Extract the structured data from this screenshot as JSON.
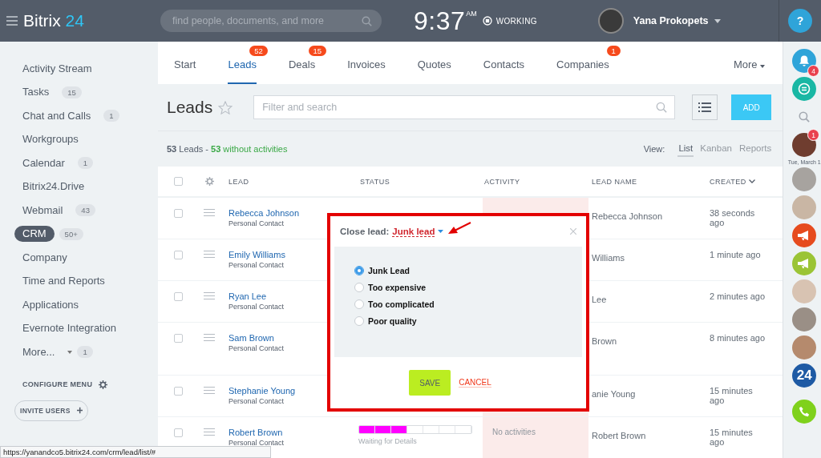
{
  "header": {
    "logo": "Bitrix",
    "logo_accent": "24",
    "search": {
      "placeholder": "find people, documents, and more"
    },
    "time": "9:37",
    "ampm": "AM",
    "work_status": "WORKING",
    "user": "Yana Prokopets",
    "help": "?"
  },
  "tabs": [
    {
      "label": "Start",
      "selected": false
    },
    {
      "label": "Leads",
      "badge": "52",
      "selected": true
    },
    {
      "label": "Deals",
      "badge": "15",
      "selected": false
    },
    {
      "label": "Invoices",
      "selected": false
    },
    {
      "label": "Quotes",
      "selected": false
    },
    {
      "label": "Contacts",
      "selected": false
    },
    {
      "label": "Companies",
      "badge": "1",
      "selected": false
    }
  ],
  "more_tab": "More",
  "sidebar": {
    "items": [
      {
        "label": "Activity Stream",
        "selected": false
      },
      {
        "label": "Tasks",
        "count": "15",
        "selected": false
      },
      {
        "label": "Chat and Calls",
        "count": "1",
        "selected": false
      },
      {
        "label": "Workgroups",
        "selected": false
      },
      {
        "label": "Calendar",
        "count": "1",
        "selected": false
      },
      {
        "label": "Bitrix24.Drive",
        "selected": false
      },
      {
        "label": "Webmail",
        "count": "43",
        "selected": false
      },
      {
        "label": "CRM",
        "count": "50+",
        "selected": true
      },
      {
        "label": "Company",
        "selected": false
      },
      {
        "label": "Time and Reports",
        "selected": false
      },
      {
        "label": "Applications",
        "selected": false
      },
      {
        "label": "Evernote Integration",
        "selected": false
      },
      {
        "label": "More...",
        "count": "1",
        "selected": false,
        "kind": "dropdown"
      }
    ],
    "configure": "CONFIGURE MENU",
    "invite": "INVITE USERS"
  },
  "page": {
    "title": "Leads",
    "filter": {
      "placeholder": "Filter and search"
    },
    "add": "ADD"
  },
  "summary": {
    "total": "53",
    "total_label": "Leads -",
    "count": "53",
    "count_label": "without activities"
  },
  "view": {
    "label": "View:",
    "options": [
      {
        "label": "List",
        "selected": true
      },
      {
        "label": "Kanban",
        "selected": false
      },
      {
        "label": "Reports",
        "selected": false
      }
    ]
  },
  "table": {
    "all_checked": false,
    "columns": [
      "LEAD",
      "STATUS",
      "ACTIVITY",
      "LEAD NAME",
      "CREATED"
    ],
    "rows": [
      {
        "checked": false,
        "name": "Rebecca Johnson",
        "subtitle": "Personal Contact",
        "lead_name": "Rebecca Johnson",
        "created": "38 seconds ago"
      },
      {
        "checked": false,
        "name": "Emily Williams",
        "subtitle": "Personal Contact",
        "lead_name": "Williams",
        "created": "1 minute ago"
      },
      {
        "checked": false,
        "name": "Ryan Lee",
        "subtitle": "Personal Contact",
        "lead_name": "Lee",
        "created": "2 minutes ago"
      },
      {
        "checked": false,
        "name": "Sam Brown",
        "subtitle": "Personal Contact",
        "lead_name": "Brown",
        "created": "8 minutes ago"
      },
      {
        "checked": false,
        "name": "Stephanie Young",
        "subtitle": "Personal Contact",
        "lead_name": "anie Young",
        "created": "15 minutes ago"
      },
      {
        "checked": false,
        "name": "Robert Brown",
        "subtitle": "Personal Contact",
        "lead_name": "Robert Brown",
        "created": "15 minutes ago",
        "status": {
          "level": 0.43,
          "label": "Waiting for Details",
          "color": "#ff00ff"
        },
        "activity": "No activities"
      }
    ]
  },
  "modal": {
    "title": "Close lead:",
    "value": "Junk lead",
    "options": [
      {
        "label": "Junk Lead",
        "selected": true
      },
      {
        "label": "Too expensive",
        "selected": false
      },
      {
        "label": "Too complicated",
        "selected": false
      },
      {
        "label": "Poor quality",
        "selected": false
      }
    ],
    "save": "SAVE",
    "cancel": "CANCEL"
  },
  "right_panel": {
    "notifications": "4",
    "chat_badge": "1",
    "date": "Tue, March 1",
    "app_tile": "24"
  },
  "status_url": "https://yanandco5.bitrix24.com/crm/lead/list/#"
}
